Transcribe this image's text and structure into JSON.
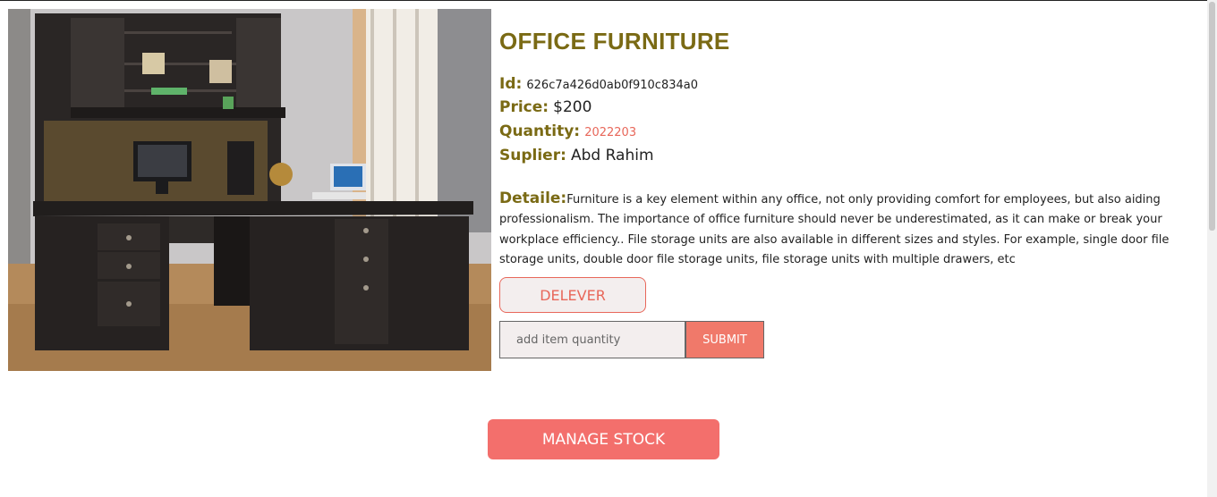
{
  "product": {
    "image_alt": "Office furniture L-shaped desk with hutch",
    "title": "OFFICE FURNITURE",
    "id_label": "Id:",
    "id_value": "626c7a426d0ab0f910c834a0",
    "price_label": "Price:",
    "price_value": "$200",
    "quantity_label": "Quantity:",
    "quantity_value": "2022203",
    "supplier_label": "Suplier:",
    "supplier_value": "Abd Rahim",
    "detail_label": "Detaile:",
    "detail_text": "Furniture is a key element within any office, not only providing comfort for employees, but also aiding professionalism. The importance of office furniture should never be underestimated, as it can make or break your workplace efficiency.. File storage units are also available in different sizes and styles. For example, single door file storage units, double door file storage units, file storage units with multiple drawers, etc"
  },
  "actions": {
    "deliver_label": "DELEVER",
    "quantity_placeholder": "add item quantity",
    "submit_label": "SUBMIT",
    "manage_stock_label": "MANAGE STOCK"
  },
  "colors": {
    "accent": "#e8675a",
    "heading": "#7a6a14",
    "button_fill": "#f36f6c"
  }
}
